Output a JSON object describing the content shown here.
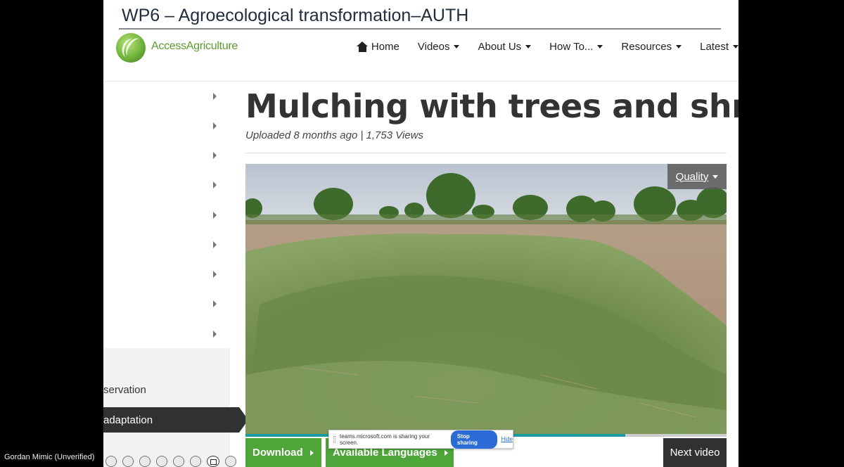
{
  "slide": {
    "title": "WP6 – Agroecological transformation–AUTH"
  },
  "site": {
    "logo_text": "AccessAgriculture",
    "nav": [
      {
        "label": "Home",
        "icon": "home-icon",
        "has_caret": false
      },
      {
        "label": "Videos",
        "has_caret": true
      },
      {
        "label": "About Us",
        "has_caret": true
      },
      {
        "label": "How To...",
        "has_caret": true
      },
      {
        "label": "Resources",
        "has_caret": true
      },
      {
        "label": "Latest",
        "has_caret": true
      }
    ]
  },
  "sidebar": {
    "item_partial_1": "servation",
    "item_partial_2": "adaptation"
  },
  "video": {
    "title": "Mulching with trees and shrubs",
    "meta": "Uploaded 8 months ago | 1,753 Views",
    "quality_label": "Quality",
    "progress": 0.79
  },
  "actions": {
    "download": "Download",
    "languages": "Available Languages",
    "next": "Next video"
  },
  "share_banner": {
    "message": "teams.microsoft.com is sharing your screen.",
    "stop": "Stop sharing",
    "hide": "Hide"
  },
  "call": {
    "participant": "Gordan Mimic (Unverified)"
  },
  "colors": {
    "accent_green": "#4ea53a",
    "dark": "#2f3133",
    "progress": "#1a9aa0",
    "teams_blue": "#2a6bd6"
  }
}
